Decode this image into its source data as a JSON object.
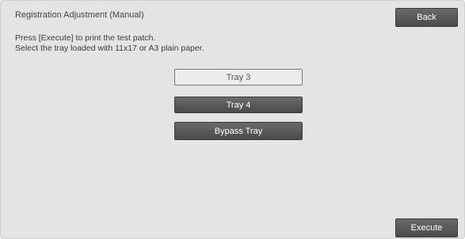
{
  "header": {
    "title": "Registration Adjustment (Manual)",
    "back_label": "Back"
  },
  "instructions": {
    "line1": "Press [Execute] to print the test patch.",
    "line2": "Select the tray loaded with 11x17 or A3 plain paper."
  },
  "trays": [
    {
      "label": "Tray 3",
      "selected": true
    },
    {
      "label": "Tray 4",
      "selected": false
    },
    {
      "label": "Bypass Tray",
      "selected": false
    }
  ],
  "footer": {
    "execute_label": "Execute"
  },
  "colors": {
    "background": "#e4e4e4",
    "button_dark": "#555555",
    "button_selected": "#ececec",
    "text": "#3a3a3a"
  }
}
